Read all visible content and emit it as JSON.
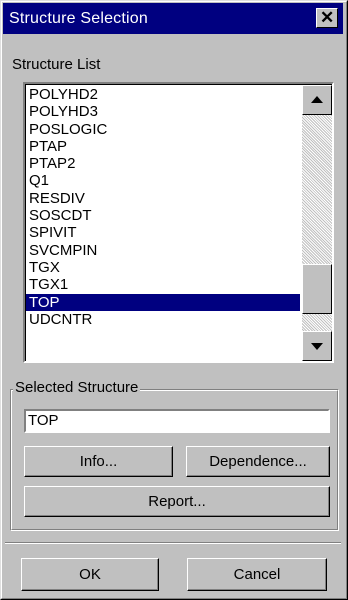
{
  "window": {
    "title": "Structure Selection",
    "close_icon": "close-icon"
  },
  "structure_list": {
    "label": "Structure List",
    "items": [
      "POLYHD2",
      "POLYHD3",
      "POSLOGIC",
      "PTAP",
      "PTAP2",
      "Q1",
      "RESDIV",
      "SOSCDT",
      "SPIVIT",
      "SVCMPIN",
      "TGX",
      "TGX1",
      "TOP",
      "UDCNTR"
    ],
    "selected_index": 12,
    "scroll_position": 0.78
  },
  "selected_structure": {
    "legend": "Selected Structure",
    "value": "TOP",
    "info_label": "Info...",
    "dependence_label": "Dependence...",
    "report_label": "Report..."
  },
  "footer": {
    "ok_label": "OK",
    "cancel_label": "Cancel"
  },
  "colors": {
    "face": "#c0c0c0",
    "title_bar": "#000080",
    "selection": "#000080"
  }
}
